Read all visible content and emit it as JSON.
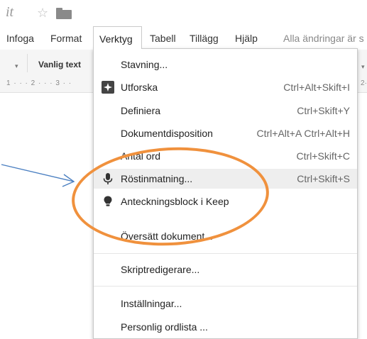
{
  "header": {
    "title_fragment": "it"
  },
  "menubar": {
    "items": [
      "Infoga",
      "Format",
      "Verktyg",
      "Tabell",
      "Tillägg",
      "Hjälp"
    ],
    "active": "Verktyg",
    "status": "Alla ändringar är s"
  },
  "toolbar": {
    "style_label": "Vanlig text"
  },
  "ruler": {
    "text": "1 · · · 2 · · · 3 · ·",
    "right_text": "2·"
  },
  "dropdown": {
    "items": [
      {
        "label": "Stavning...",
        "shortcut": "",
        "icon": ""
      },
      {
        "label": "Utforska",
        "shortcut": "Ctrl+Alt+Skift+I",
        "icon": "explore-icon"
      },
      {
        "label": "Definiera",
        "shortcut": "Ctrl+Skift+Y",
        "icon": ""
      },
      {
        "label": "Dokumentdisposition",
        "shortcut": "Ctrl+Alt+A Ctrl+Alt+H",
        "icon": ""
      },
      {
        "label": "Antal ord",
        "shortcut": "Ctrl+Skift+C",
        "icon": ""
      },
      {
        "label": "Röstinmatning...",
        "shortcut": "Ctrl+Skift+S",
        "icon": "microphone-icon",
        "highlighted": true
      },
      {
        "label": "Anteckningsblock i Keep",
        "shortcut": "",
        "icon": "keep-bulb-icon"
      },
      {
        "label": "Översätt dokument...",
        "shortcut": "",
        "icon": ""
      },
      {
        "label": "Skriptredigerare...",
        "shortcut": "",
        "icon": ""
      },
      {
        "label": "Inställningar...",
        "shortcut": "",
        "icon": ""
      },
      {
        "label": "Personlig ordlista ...",
        "shortcut": "",
        "icon": ""
      }
    ]
  },
  "annotation": {
    "ellipse_color": "#f0913d",
    "arrow_color": "#4a7fc1"
  }
}
